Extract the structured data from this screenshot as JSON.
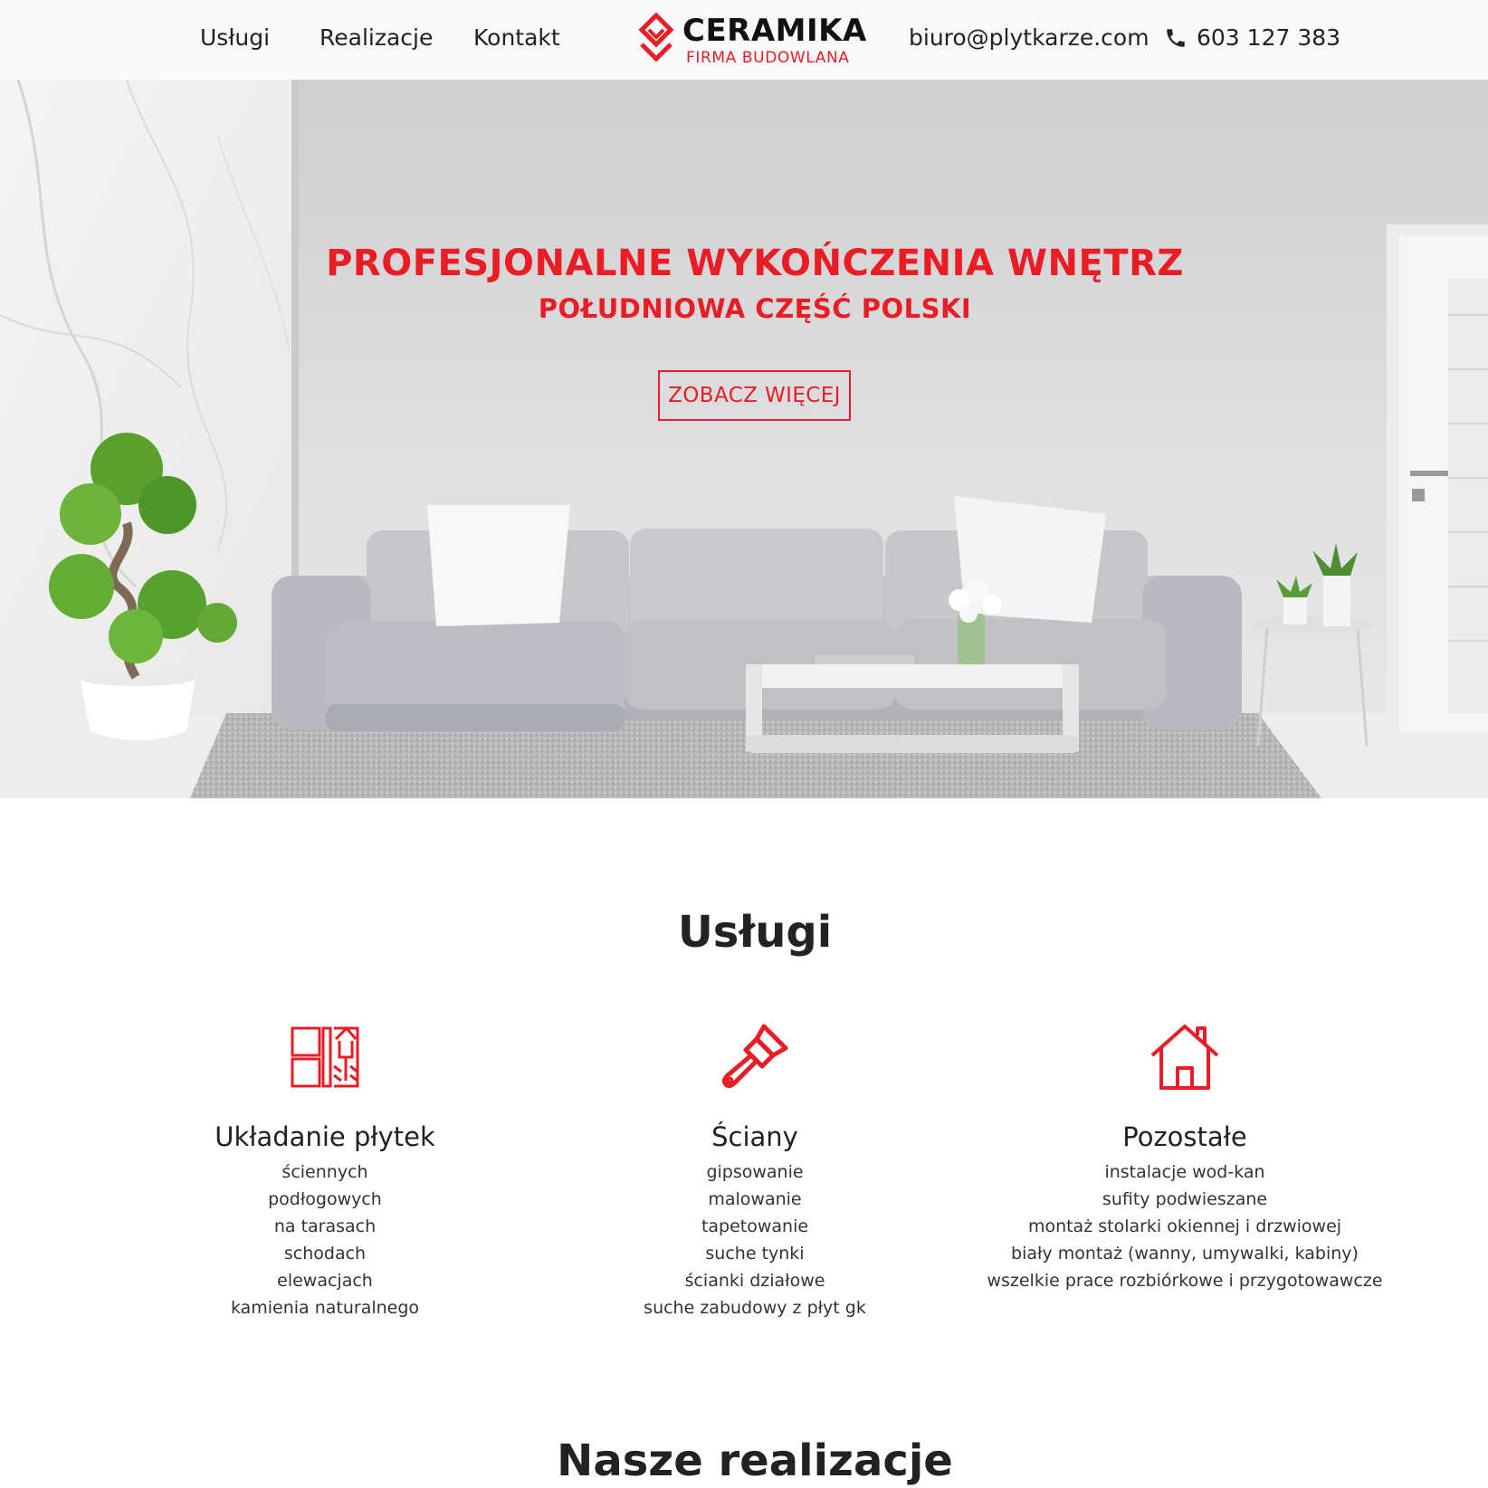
{
  "header": {
    "nav": [
      {
        "label": "Usługi"
      },
      {
        "label": "Realizacje"
      },
      {
        "label": "Kontakt"
      }
    ],
    "logo": {
      "title": "CERAMIKA",
      "subtitle": "FIRMA BUDOWLANA",
      "icon": "diamond-logo-icon"
    },
    "email": "biuro@plytkarze.com",
    "phone": "603 127 383",
    "phone_icon": "phone-icon"
  },
  "hero": {
    "title": "PROFESJONALNE WYKOŃCZENIA WNĘTRZ",
    "subtitle": "POŁUDNIOWA CZĘŚĆ POLSKI",
    "button_label": "ZOBACZ WIĘCEJ"
  },
  "services": {
    "title": "Usługi",
    "items": [
      {
        "icon": "tiles-trowel-icon",
        "name": "Układanie płytek",
        "lines": [
          "ściennych",
          "podłogowych",
          "na tarasach",
          "schodach",
          "elewacjach",
          "kamienia naturalnego"
        ]
      },
      {
        "icon": "paint-brush-icon",
        "name": "Ściany",
        "lines": [
          "gipsowanie",
          "malowanie",
          "tapetowanie",
          "suche tynki",
          "ścianki działowe",
          "suche zabudowy z płyt gk"
        ]
      },
      {
        "icon": "house-icon",
        "name": "Pozostałe",
        "lines": [
          "instalacje wod-kan",
          "sufity podwieszane",
          "montaż stolarki okiennej i drzwiowej",
          "biały montaż (wanny, umywalki, kabiny)",
          "wszelkie prace rozbiórkowe i przygotowawcze"
        ]
      }
    ]
  },
  "realizations": {
    "title": "Nasze realizacje"
  },
  "colors": {
    "accent": "#ea1c24",
    "text": "#222222",
    "header_bg": "#f8f9fa"
  }
}
